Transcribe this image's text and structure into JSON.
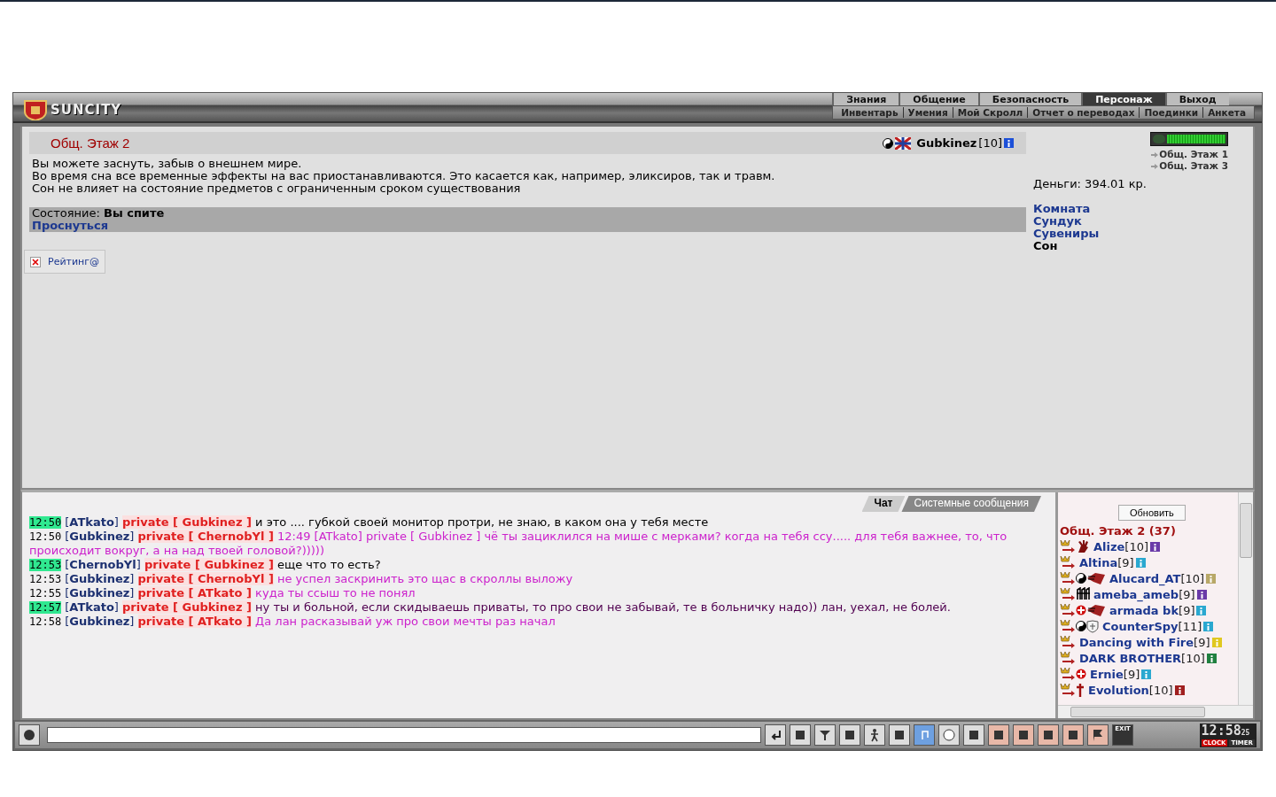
{
  "header": {
    "logo": "SUNCITY",
    "nav_top": [
      {
        "label": "Знания",
        "selected": false
      },
      {
        "label": "Общение",
        "selected": false
      },
      {
        "label": "Безопасность",
        "selected": false
      },
      {
        "label": "Персонаж",
        "selected": true
      },
      {
        "label": "Выход",
        "selected": false
      }
    ],
    "nav_sub": [
      "Инвентарь",
      "Умения",
      "Мой Скролл",
      "Отчет о переводах",
      "Поединки",
      "Анкета"
    ]
  },
  "room": {
    "title": "Общ. Этаж 2",
    "player": {
      "name": "Gubkinez",
      "level": "[10]",
      "icons": [
        {
          "kind": "yin-yang"
        },
        {
          "kind": "flag"
        }
      ]
    },
    "description": [
      "Вы можете заснуть, забыв о внешнем мире.",
      "Во время сна все временные эффекты на вас приостанавливаются. Это касается как, например, эликсиров, так и травм.",
      "Сон не влияет на состояние предметов с ограниченным сроком существования"
    ],
    "status": "Состояние: **Вы спите**",
    "status_action": "Проснуться",
    "rating": "Рейтинг@"
  },
  "sidebar": {
    "power": {
      "level": 1
    },
    "exits": [
      "Общ. Этаж 1",
      "Общ. Этаж 3"
    ],
    "money": "Деньги: 394.01 кр.",
    "links": [
      {
        "label": "Комната",
        "selected": false
      },
      {
        "label": "Сундук",
        "selected": false
      },
      {
        "label": "Сувениры",
        "selected": false
      },
      {
        "label": "Сон",
        "selected": true
      }
    ]
  },
  "chat": {
    "tabs": [
      {
        "label": "Чат",
        "selected": true
      },
      {
        "label": "Системные сообщения",
        "selected": false
      }
    ],
    "messages": [
      {
        "time": "12:50",
        "highlighted": true,
        "sender": "[**ATkato**]",
        "private": "private [ Gubkinez ]",
        "text": "и это .... губкой своей монитор протри, не знаю, в каком она у тебя месте",
        "color": "#000000"
      },
      {
        "time": "12:50",
        "highlighted": false,
        "sender": "[**Gubkinez**]",
        "private": "private [ ChernobYl ]",
        "text": "12:49 [ATkato] private [ Gubkinez ] чё ты зациклился на мише с мерками? когда на тебя ссу..... для тебя важнее, то, что",
        "text_wrapped": "происходит вокруг, а на над твоей головой?)))))",
        "color": "#cc22cc"
      },
      {
        "time": "12:53",
        "highlighted": true,
        "sender": "[**ChernobYl**]",
        "private": "private [ Gubkinez ]",
        "text": "еще что то есть?",
        "color": "#000000"
      },
      {
        "time": "12:53",
        "highlighted": false,
        "sender": "[**Gubkinez**]",
        "private": "private [ ChernobYl ]",
        "text": "не успел заскринить это щас в скроллы выложу",
        "color": "#cc22cc"
      },
      {
        "time": "12:55",
        "highlighted": false,
        "sender": "[**Gubkinez**]",
        "private": "private [ ATkato ]",
        "text": "куда ты ссыш то не понял",
        "color": "#cc22cc"
      },
      {
        "time": "12:57",
        "highlighted": true,
        "sender": "[**ATkato**]",
        "private": "private [ Gubkinez ]",
        "text": "ну ты и больной, если скидываешь приваты, то про свои не забывай, те в больничку надо)) лан, уехал, не болей.",
        "color": "#500050"
      },
      {
        "time": "12:58",
        "highlighted": false,
        "sender": "[**Gubkinez**]",
        "private": "private [ ATkato ]",
        "text": "Да лан расказывай уж про свои мечты раз начал",
        "color": "#cc22cc"
      }
    ]
  },
  "users": {
    "refresh": "Обновить",
    "room": "Общ. Этаж 2 (37)",
    "list": [
      {
        "name": "Alize",
        "level": "[10]",
        "color": "#6a3aa8",
        "icons": [
          {
            "kind": "hand"
          }
        ]
      },
      {
        "name": "Altina",
        "level": "[9]",
        "color": "#2aa8d0"
      },
      {
        "name": "Alucard_AT",
        "level": "[10]",
        "color": "#b8a868",
        "icons": [
          {
            "kind": "yin-yang"
          },
          {
            "kind": "emblem"
          }
        ]
      },
      {
        "name": "ameba_ameb",
        "level": "[9]",
        "color": "#6a3aa8",
        "icons": [
          {
            "kind": "gothic"
          }
        ]
      },
      {
        "name": "armada bk",
        "level": "[9]",
        "color": "#2aa8d0",
        "icons": [
          {
            "kind": "cross"
          },
          {
            "kind": "emblem"
          }
        ]
      },
      {
        "name": "CounterSpy",
        "level": "[11]",
        "color": "#2aa8d0",
        "icons": [
          {
            "kind": "yin-yang"
          },
          {
            "kind": "shield"
          }
        ]
      },
      {
        "name": "Dancing with Fire",
        "level": "[9]",
        "color": "#e0c820"
      },
      {
        "name": "DARK BROTHER",
        "level": "[10]",
        "color": "#208040"
      },
      {
        "name": "Ernie",
        "level": "[9]",
        "color": "#2aa8d0",
        "icons": [
          {
            "kind": "cross"
          }
        ]
      },
      {
        "name": "Evolution",
        "level": "[10]",
        "color": "#a02020",
        "icons": [
          {
            "kind": "dagger"
          }
        ]
      }
    ]
  },
  "toolbar": {
    "exit_label": "EXIT",
    "clock": "12:58",
    "seconds": "25",
    "clock_label": "CLOCK",
    "timer_label": "TIMER"
  }
}
